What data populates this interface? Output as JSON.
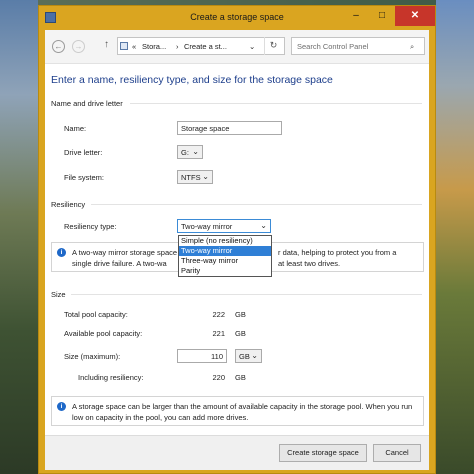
{
  "window": {
    "title": "Create a storage space",
    "minimize": "–",
    "maximize": "□",
    "close": "✕"
  },
  "nav": {
    "back": "←",
    "forward": "→",
    "up": "↑",
    "breadcrumb_prefix": "«",
    "breadcrumb_1": "Stora...",
    "breadcrumb_sep": "›",
    "breadcrumb_2": "Create a st...",
    "chevron": "⌄",
    "refresh": "↻",
    "search_placeholder": "Search Control Panel"
  },
  "heading": "Enter a name, resiliency type, and size for the storage space",
  "name_section": {
    "title": "Name and drive letter",
    "name_label": "Name:",
    "name_value": "Storage space",
    "drive_label": "Drive letter:",
    "drive_value": "G:",
    "fs_label": "File system:",
    "fs_value": "NTFS"
  },
  "resiliency": {
    "title": "Resiliency",
    "type_label": "Resiliency type:",
    "type_value": "Two-way mirror",
    "options": [
      "Simple (no resiliency)",
      "Two-way mirror",
      "Three-way mirror",
      "Parity"
    ],
    "info_part1": "A two-way mirror storage space",
    "info_part1_end": "r data, helping to protect you from a",
    "info_part2": "single drive failure. A two-wa",
    "info_part2_end": "at least two drives."
  },
  "size": {
    "title": "Size",
    "total_label": "Total pool capacity:",
    "total_value": "222",
    "total_unit": "GB",
    "available_label": "Available pool capacity:",
    "available_value": "221",
    "available_unit": "GB",
    "max_label": "Size (maximum):",
    "max_value": "110",
    "max_unit": "GB",
    "including_label": "Including resiliency:",
    "including_value": "220",
    "including_unit": "GB",
    "info": "A storage space can be larger than the amount of available capacity in the storage pool. When you run low on capacity in the pool, you can add more drives."
  },
  "footer": {
    "create_label": "Create storage space",
    "cancel_label": "Cancel"
  },
  "colors": {
    "title_bar": "#daa520",
    "heading": "#1e3f8c",
    "selected_option": "#2f7fd6",
    "info_icon": "#1e68c8"
  }
}
